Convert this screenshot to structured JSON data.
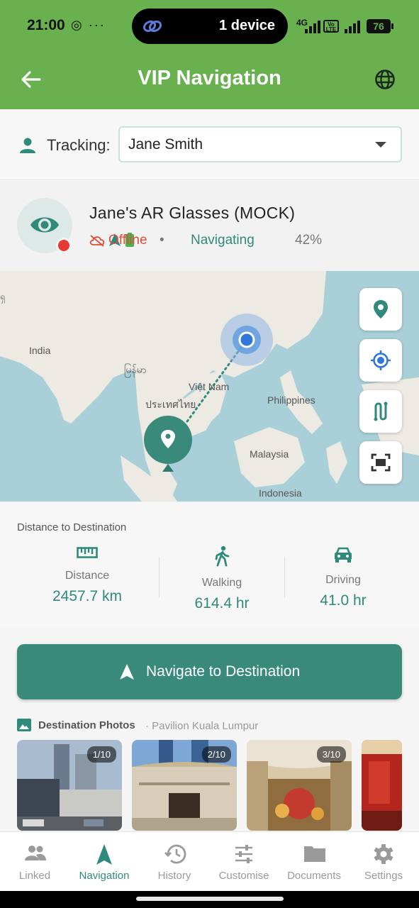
{
  "status_bar": {
    "time": "21:00",
    "left_icons": "◎ ···",
    "pill_text": "1 device",
    "network": "4G",
    "volte": "Vo LTE",
    "battery": "76"
  },
  "app_bar": {
    "title": "VIP Navigation",
    "back_icon": "arrow-left-icon",
    "language_icon": "globe-icon"
  },
  "tracking": {
    "label": "Tracking:",
    "selected": "Jane Smith"
  },
  "device": {
    "name": "Jane's AR Glasses (MOCK)",
    "connection": "Offline",
    "separator": "•",
    "state": "Navigating",
    "battery": "42%",
    "colors": {
      "offline": "#e04b3a",
      "accent": "#2f8a7b"
    }
  },
  "map": {
    "places": {
      "india": "India",
      "myanmar": "မြန်မာ",
      "vietnam": "Việt Nam",
      "thailand": "ประเทศไทย",
      "philippines": "Philippines",
      "malaysia": "Malaysia",
      "indonesia": "Indonesia",
      "edge": "ရှ"
    },
    "controls": [
      "location-pin-icon",
      "my-location-icon",
      "route-icon",
      "fit-bounds-icon"
    ]
  },
  "distance": {
    "title": "Distance to Destination",
    "stats": [
      {
        "label": "Distance",
        "value": "2457.7 km",
        "icon": "ruler-icon"
      },
      {
        "label": "Walking",
        "value": "614.4 hr",
        "icon": "walking-icon"
      },
      {
        "label": "Driving",
        "value": "41.0 hr",
        "icon": "car-icon"
      }
    ]
  },
  "navigate_button": {
    "label": "Navigate to Destination"
  },
  "photos": {
    "title": "Destination Photos",
    "subtitle": "· Pavilion Kuala Lumpur",
    "items": [
      {
        "badge": "1/10"
      },
      {
        "badge": "2/10"
      },
      {
        "badge": "3/10"
      }
    ]
  },
  "bottom_nav": {
    "active": "Navigation",
    "tabs": [
      "Linked",
      "Navigation",
      "History",
      "Customise",
      "Documents",
      "Settings"
    ]
  },
  "theme": {
    "primary": "#69b04f",
    "accent": "#3a8a7c"
  }
}
